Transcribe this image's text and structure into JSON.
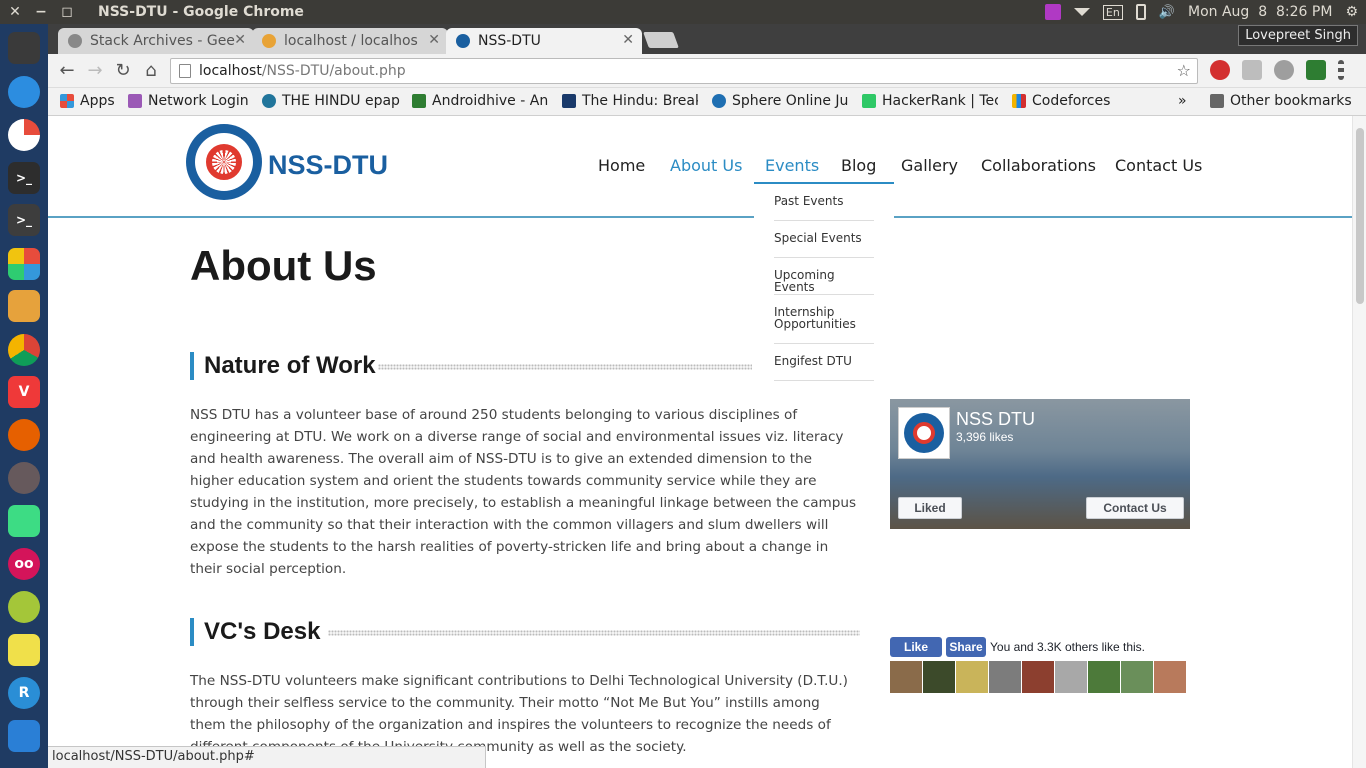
{
  "os": {
    "window_title": "NSS-DTU - Google Chrome",
    "close_glyph": "✕",
    "minimize_glyph": "−",
    "maximize_glyph": "◻",
    "keyboard_layout": "En",
    "datetime": "Mon Aug  8  8:26 PM",
    "volume_glyph": "🔊",
    "power_glyph": "⚙",
    "launcher_icons": [
      "dash-icon",
      "dash-dots-icon",
      "disk-usage-icon",
      "terminal-icon",
      "terminal-alt-icon",
      "software-center-icon",
      "files-icon",
      "chrome-icon",
      "vivaldi-icon",
      "firefox-icon",
      "atom-icon",
      "android-studio-icon",
      "flickr-icon",
      "android-icon",
      "lamp-icon",
      "rstudio-icon",
      "update-icon"
    ]
  },
  "browser": {
    "tabs": [
      {
        "title": "Stack Archives - Gee",
        "active": false,
        "color": "#888888"
      },
      {
        "title": "localhost / localhos",
        "active": false,
        "color": "#e8a336"
      },
      {
        "title": "NSS-DTU",
        "active": true,
        "color": "#1a5fa0"
      }
    ],
    "tab_close_glyph": "✕",
    "user": "Lovepreet Singh",
    "url_host": "localhost",
    "url_path": "/NSS-DTU/about.php",
    "back_glyph": "←",
    "forward_glyph": "→",
    "reload_glyph": "↻",
    "home_glyph": "⌂",
    "star_glyph": "☆",
    "bookmarks": [
      {
        "label": "Apps",
        "color": "#e74c3c"
      },
      {
        "label": "Network Login",
        "color": "#9b59b6"
      },
      {
        "label": "THE HINDU epap",
        "color": "#21759b"
      },
      {
        "label": "Androidhive - An",
        "color": "#2e7d32"
      },
      {
        "label": "The Hindu: Break",
        "color": "#1a3a6b"
      },
      {
        "label": "Sphere Online Ju",
        "color": "#1f6fb2"
      },
      {
        "label": "HackerRank | Tec",
        "color": "#2ec866"
      },
      {
        "label": "Codeforces",
        "color": "#f4b400"
      }
    ],
    "bookmarks_more": "»",
    "other_bookmarks": "Other bookmarks",
    "status_url": "localhost/NSS-DTU/about.php#"
  },
  "site": {
    "brand": "NSS-DTU",
    "nav": [
      "Home",
      "About Us",
      "Events",
      "Blog",
      "Gallery",
      "Collaborations",
      "Contact Us"
    ],
    "dropdown": [
      "Past Events",
      "Special Events",
      "Upcoming Events",
      "Internship Opportunities",
      "Engifest DTU"
    ],
    "page_title": "About Us",
    "section1_title": "Nature of Work",
    "section1_body": "NSS DTU has a volunteer base of around 250 students belonging to various disciplines of engineering at DTU. We work on a diverse range of social and environmental issues viz. literacy and health awareness. The overall aim of NSS-DTU is to give an extended dimension to the higher education system and orient the students towards community service while they are studying in the institution, more precisely, to establish a meaningful linkage between the campus and the community so that their interaction with the common villagers and slum dwellers will expose the students to the harsh realities of poverty-stricken life and bring about a change in their social perception.",
    "section2_title": "VC's Desk",
    "section2_body": "The NSS-DTU volunteers make significant contributions to Delhi Technological University (D.T.U.) through their selfless service to the community. Their motto “Not Me But You” instills among them the philosophy of the organization and inspires the volunteers to recognize the needs of different components of the University community as well as the society.",
    "fb_page": {
      "name": "NSS DTU",
      "likes": "3,396 likes",
      "liked_label": "Liked",
      "contact_label": "Contact Us"
    },
    "fb_like": {
      "like_label": "Like",
      "share_label": "Share",
      "text": "You and 3.3K others like this."
    }
  }
}
